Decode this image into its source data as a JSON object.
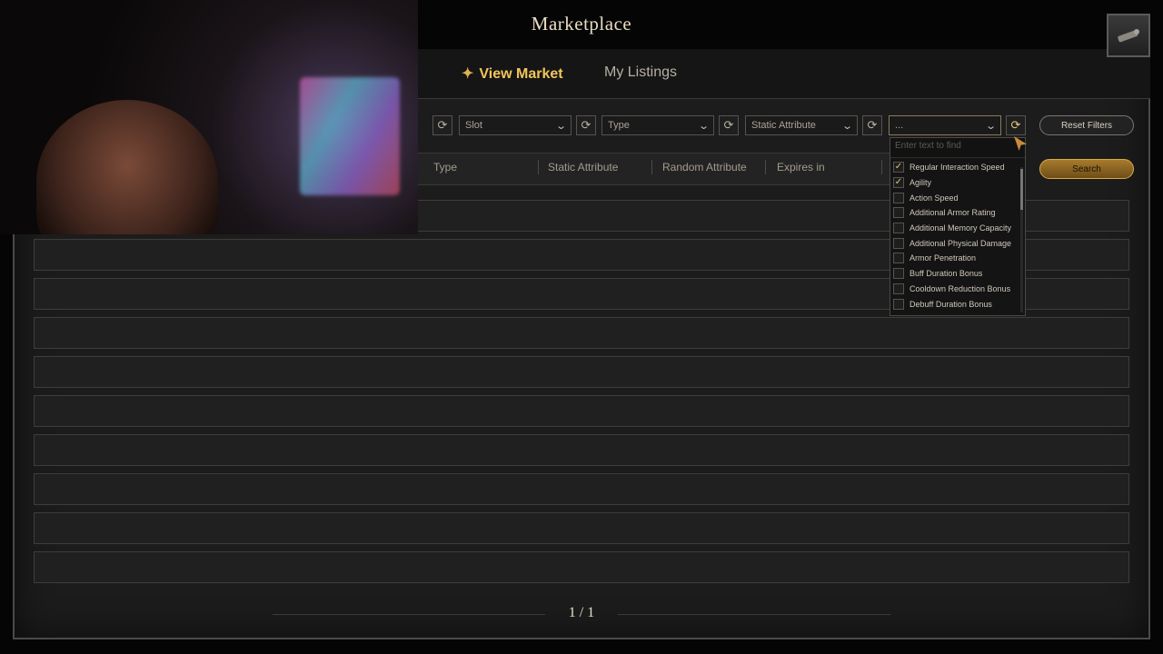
{
  "header": {
    "title": "Marketplace"
  },
  "tabs": [
    {
      "label": "View Market",
      "active": true
    },
    {
      "label": "My Listings",
      "active": false
    }
  ],
  "filters": {
    "slot": "Slot",
    "type": "Type",
    "static_attribute": "Static Attribute",
    "random_attribute": "...",
    "reset_label": "Reset Filters",
    "search_label": "Search"
  },
  "columns": [
    "Type",
    "Static Attribute",
    "Random Attribute",
    "Expires in"
  ],
  "dropdown": {
    "placeholder": "Enter text to find",
    "options": [
      {
        "label": "Regular Interaction Speed",
        "checked": true
      },
      {
        "label": "Agility",
        "checked": true
      },
      {
        "label": "Action Speed",
        "checked": false
      },
      {
        "label": "Additional Armor Rating",
        "checked": false
      },
      {
        "label": "Additional Memory Capacity",
        "checked": false
      },
      {
        "label": "Additional Physical Damage",
        "checked": false
      },
      {
        "label": "Armor Penetration",
        "checked": false
      },
      {
        "label": "Buff Duration Bonus",
        "checked": false
      },
      {
        "label": "Cooldown Reduction Bonus",
        "checked": false
      },
      {
        "label": "Debuff Duration Bonus",
        "checked": false
      }
    ]
  },
  "pagination": {
    "text": "1 / 1"
  },
  "colors": {
    "accent": "#f2c55a",
    "search_button": "#a77b2c"
  },
  "icons": {
    "top_right": "map-icon",
    "refresh": "refresh-icon",
    "dropdown": "chevron-down-icon"
  }
}
